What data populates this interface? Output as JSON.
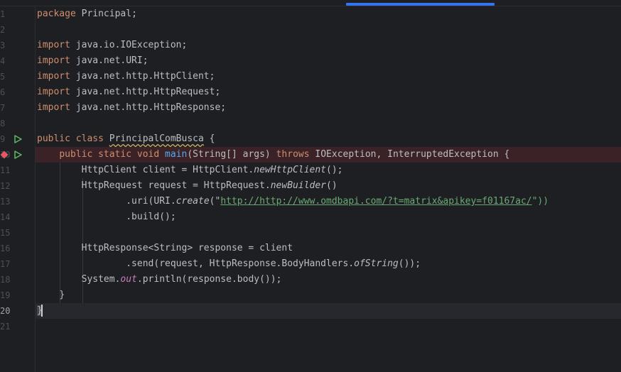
{
  "gutter": {
    "line_numbers": [
      "1",
      "2",
      "3",
      "4",
      "5",
      "6",
      "7",
      "8",
      "9",
      "10",
      "11",
      "12",
      "13",
      "14",
      "15",
      "16",
      "17",
      "18",
      "19",
      "20",
      "21"
    ],
    "active_line_number": "20"
  },
  "code": {
    "l1_kw": "package",
    "l1_rest": " Principal;",
    "import_kw": "import",
    "l3_rest": " java.io.IOException;",
    "l4_rest": " java.net.URI;",
    "l5_rest": " java.net.http.HttpClient;",
    "l6_rest": " java.net.http.HttpRequest;",
    "l7_rest": " java.net.http.HttpResponse;",
    "l9_public": "public",
    "l9_class": "class",
    "l9_name": "PrincipalComBusca",
    "l9_brace": " {",
    "l10_public": "public",
    "l10_static": "static",
    "l10_void": "void",
    "l10_main": "main",
    "l10_params": "(String[] args) ",
    "l10_throws": "throws",
    "l10_exceptions": " IOException, InterruptedException {",
    "l11_a": "HttpClient client = HttpClient.",
    "l11_method": "newHttpClient",
    "l11_b": "();",
    "l12_a": "HttpRequest request = HttpRequest.",
    "l12_method": "newBuilder",
    "l12_b": "()",
    "l13_a": ".uri(URI.",
    "l13_method": "create",
    "l13_q1": "(\"",
    "l13_url": "http://http://www.omdbapi.com/?t=matrix&apikey=f01167ac/",
    "l13_q2": "\"))",
    "l14": ".build();",
    "l16": "HttpResponse<String> response = client",
    "l17_a": ".send(request, HttpResponse.BodyHandlers.",
    "l17_method": "ofString",
    "l17_b": "());",
    "l18_a": "System.",
    "l18_field": "out",
    "l18_b": ".println(response.body());",
    "l19": "}",
    "l20": "}"
  },
  "colors": {
    "background": "#1e1f22",
    "keyword": "#cf8e6d",
    "function_decl": "#56a8f5",
    "string": "#6aab73",
    "static_field": "#c77dbb",
    "breakpoint": "#e55765",
    "run_icon": "#5fb865",
    "scroll_indicator": "#3574f0"
  },
  "icons": {
    "run": "run-gutter-icon",
    "breakpoint": "breakpoint-icon"
  }
}
